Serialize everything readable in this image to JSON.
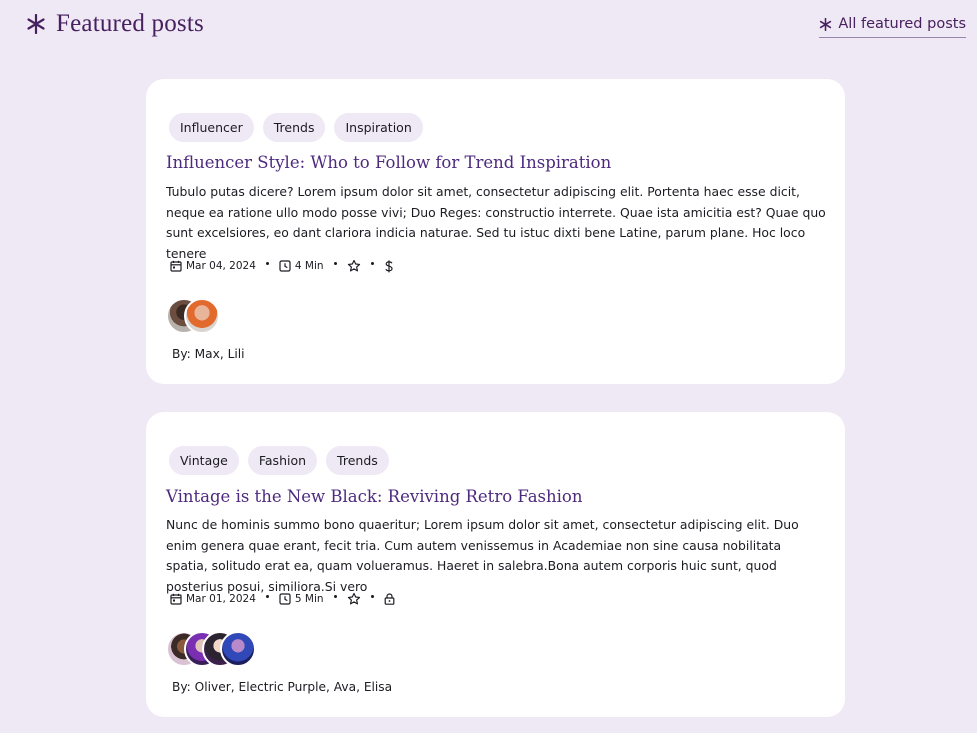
{
  "header": {
    "title": "Featured posts",
    "link_label": "All featured posts",
    "title_icon": "sparkle-icon",
    "link_icon": "sparkle-icon"
  },
  "posts": [
    {
      "tags": [
        "Influencer",
        "Trends",
        "Inspiration"
      ],
      "title": "Influencer Style: Who to Follow for Trend Inspiration",
      "excerpt": "Tubulo putas dicere? Lorem ipsum dolor sit amet, consectetur adipiscing elit. Portenta haec esse dicit, neque ea ratione ullo modo posse vivi; Duo Reges: constructio interrete. Quae ista amicitia est? Quae quo sunt excelsiores, eo dant clariora indicia naturae. Sed tu istuc dixti bene Latine, parum plane. Hoc loco tenere",
      "date": "Mar 04, 2024",
      "read_time": "4 Min",
      "access_icon": "dollar-icon",
      "byline": "By: Max, Lili",
      "avatar_count": 2
    },
    {
      "tags": [
        "Vintage",
        "Fashion",
        "Trends"
      ],
      "title": "Vintage is the New Black: Reviving Retro Fashion",
      "excerpt": "Nunc de hominis summo bono quaeritur; Lorem ipsum dolor sit amet, consectetur adipiscing elit. Duo enim genera quae erant, fecit tria. Cum autem venissemus in Academiae non sine causa nobilitata spatia, solitudo erat ea, quam volueramus. Haeret in salebra.Bona autem corporis huic sunt, quod posterius posui, similiora.Si vero",
      "date": "Mar 01, 2024",
      "read_time": "5 Min",
      "access_icon": "lock-icon",
      "byline": "By: Oliver, Electric Purple, Ava, Elisa",
      "avatar_count": 4
    }
  ],
  "colors": {
    "background": "#efe8f5",
    "accent": "#47205e",
    "title": "#4d2a7e",
    "tag_bg": "#efe8f5",
    "card": "#ffffff"
  }
}
